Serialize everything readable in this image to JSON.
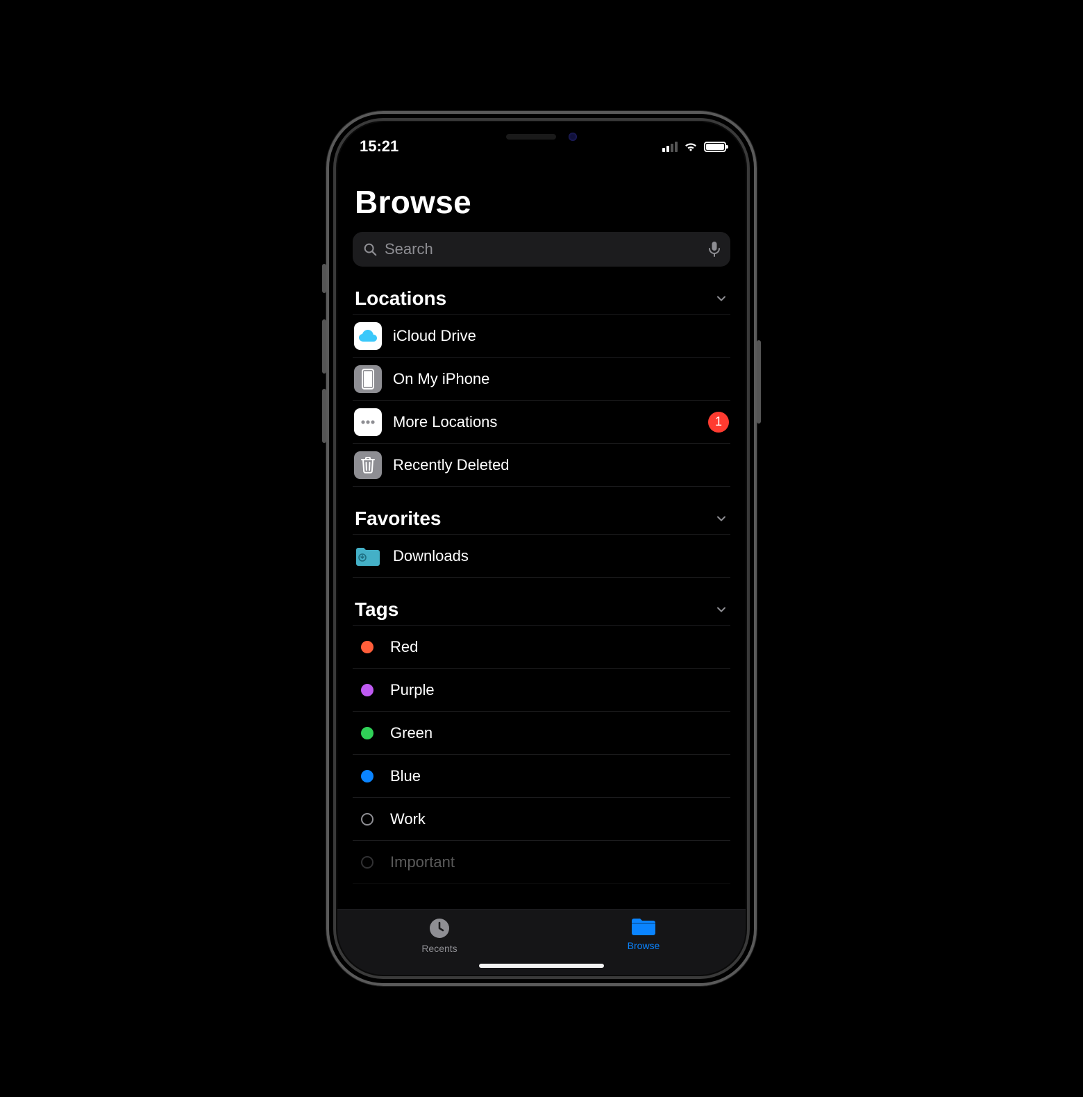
{
  "status": {
    "time": "15:21"
  },
  "page": {
    "title": "Browse"
  },
  "search": {
    "placeholder": "Search"
  },
  "sections": {
    "locations": {
      "title": "Locations",
      "items": [
        {
          "label": "iCloud Drive"
        },
        {
          "label": "On My iPhone"
        },
        {
          "label": "More Locations",
          "badge": "1"
        },
        {
          "label": "Recently Deleted"
        }
      ]
    },
    "favorites": {
      "title": "Favorites",
      "items": [
        {
          "label": "Downloads"
        }
      ]
    },
    "tags": {
      "title": "Tags",
      "items": [
        {
          "label": "Red",
          "color": "#ff5e3a"
        },
        {
          "label": "Purple",
          "color": "#bf5af2"
        },
        {
          "label": "Green",
          "color": "#30d158"
        },
        {
          "label": "Blue",
          "color": "#0a84ff"
        },
        {
          "label": "Work",
          "color": null
        },
        {
          "label": "Important",
          "color": null
        }
      ]
    }
  },
  "tabbar": {
    "recents": "Recents",
    "browse": "Browse"
  }
}
